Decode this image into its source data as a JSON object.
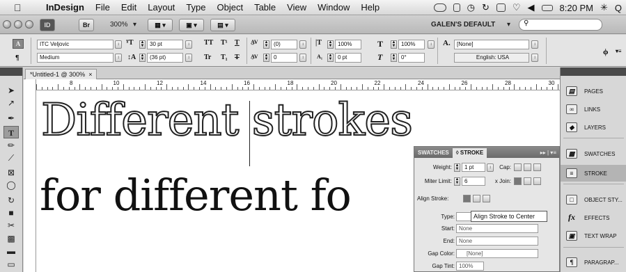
{
  "menubar": {
    "app": "InDesign",
    "items": [
      "File",
      "Edit",
      "Layout",
      "Type",
      "Object",
      "Table",
      "View",
      "Window",
      "Help"
    ],
    "clock": "8:20 PM",
    "search_glyph": "Q"
  },
  "appbar": {
    "app_badge": "ID",
    "bridge_badge": "Br",
    "zoom": "300%",
    "workspace": "GALEN'S DEFAULT"
  },
  "control": {
    "font": "ITC Veljovic",
    "style": "Medium",
    "size": "30 pt",
    "leading": "(36 pt)",
    "tracking": "(0)",
    "kerning": "0",
    "vscale": "100%",
    "hscale": "100%",
    "baseline": "0 pt",
    "skew": "0°",
    "char_style": "[None]",
    "language": "English: USA",
    "tt_labels": [
      "TT",
      "T¹",
      "T",
      "Tr",
      "T₁",
      "T"
    ]
  },
  "document": {
    "tab_title": "*Untitled-1 @ 300%",
    "ruler_numbers": [
      "8",
      "10",
      "12",
      "14",
      "16",
      "18",
      "20",
      "22",
      "24",
      "26",
      "28",
      "30"
    ],
    "line1": "Different strokes",
    "line2": "for different fo"
  },
  "stroke_panel": {
    "tabs": [
      "SWATCHES",
      "◊ STROKE"
    ],
    "weight_label": "Weight:",
    "weight": "1 pt",
    "cap_label": "Cap:",
    "miter_label": "Miter Limit:",
    "miter": "6",
    "join_label": "x  Join:",
    "align_label": "Align Stroke:",
    "type_label": "Type:",
    "start_label": "Start:",
    "start": "None",
    "end_label": "End:",
    "end": "None",
    "gap_color_label": "Gap Color:",
    "gap_color": "[None]",
    "gap_tint_label": "Gap Tint:",
    "gap_tint": "100%",
    "tooltip": "Align Stroke to Center"
  },
  "dock": {
    "items": [
      "PAGES",
      "LINKS",
      "LAYERS",
      "SWATCHES",
      "STROKE",
      "OBJECT STY...",
      "EFFECTS",
      "TEXT WRAP",
      "PARAGRAP..."
    ],
    "icons": [
      "pages-icon",
      "links-icon",
      "layers-icon",
      "swatches-icon",
      "stroke-icon",
      "object-styles-icon",
      "effects-icon",
      "text-wrap-icon",
      "paragraph-styles-icon"
    ],
    "selected": "STROKE"
  }
}
